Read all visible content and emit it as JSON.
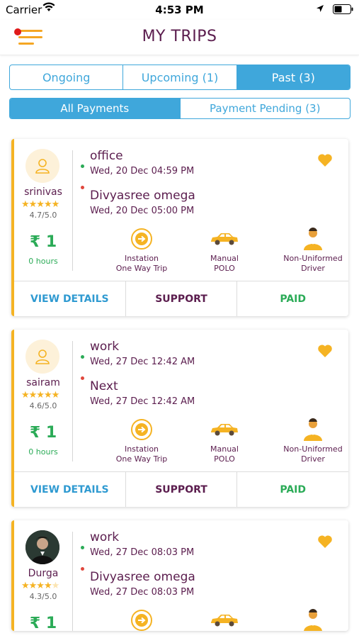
{
  "status": {
    "carrier": "Carrier",
    "time": "4:53 PM"
  },
  "header": {
    "title": "MY TRIPS"
  },
  "trip_tabs": [
    "Ongoing",
    "Upcoming (1)",
    "Past (3)"
  ],
  "payment_tabs": [
    "All Payments",
    "Payment Pending (3)"
  ],
  "colors": {
    "accent": "#3fa7db",
    "brand": "#5b1d4e",
    "gold": "#f5b323",
    "green": "#2bab57"
  },
  "trips": [
    {
      "driver": "srinivas",
      "stars": 4.7,
      "rating": "4.7/5.0",
      "fare": "₹ 1",
      "duration": "0 hours",
      "from_name": "office",
      "from_time": "Wed, 20 Dec 04:59 PM",
      "to_name": "Divyasree omega",
      "to_time": "Wed, 20 Dec 05:00 PM",
      "trip_type_1": "Instation",
      "trip_type_2": "One Way Trip",
      "car_1": "Manual",
      "car_2": "POLO",
      "driver_type_1": "Non-Uniformed",
      "driver_type_2": "Driver",
      "view": "VIEW DETAILS",
      "support": "SUPPORT",
      "status": "PAID"
    },
    {
      "driver": "sairam",
      "stars": 4.6,
      "rating": "4.6/5.0",
      "fare": "₹ 1",
      "duration": "0 hours",
      "from_name": "work",
      "from_time": "Wed, 27 Dec 12:42 AM",
      "to_name": "Next",
      "to_time": "Wed, 27 Dec 12:42 AM",
      "trip_type_1": "Instation",
      "trip_type_2": "One Way Trip",
      "car_1": "Manual",
      "car_2": "POLO",
      "driver_type_1": "Non-Uniformed",
      "driver_type_2": "Driver",
      "view": "VIEW DETAILS",
      "support": "SUPPORT",
      "status": "PAID"
    },
    {
      "driver": "Durga",
      "stars": 4.3,
      "rating": "4.3/5.0",
      "fare": "₹ 1",
      "from_name": "work",
      "from_time": "Wed, 27 Dec 08:03 PM",
      "to_name": "Divyasree omega",
      "to_time": "Wed, 27 Dec 08:03 PM"
    }
  ]
}
